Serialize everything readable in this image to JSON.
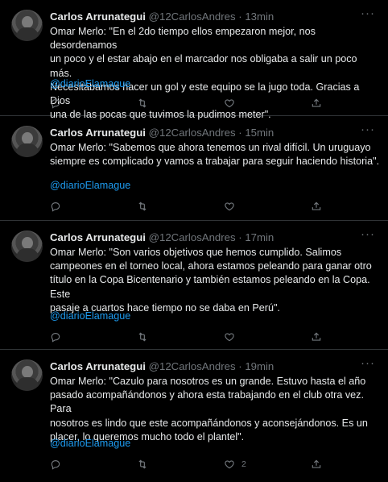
{
  "tweets": [
    {
      "name": "Carlos Arrunategui",
      "handle": "@12CarlosAndres",
      "dot": "·",
      "time": "13min",
      "lines": [
        "Omar Merlo: \"En el 2do tiempo ellos empezaron mejor, nos desordenamos",
        "un poco y el estar abajo en el marcador nos obligaba a salir un poco más.",
        "Necesitábamos hacer un gol y este equipo se la jugo toda. Gracias a Dios",
        "una de las pocas que tuvimos la pudimos meter\"."
      ],
      "link": "@diarioElamague",
      "likes": ""
    },
    {
      "name": "Carlos Arrunategui",
      "handle": "@12CarlosAndres",
      "dot": "·",
      "time": "15min",
      "lines": [
        "Omar Merlo: \"Sabemos que ahora tenemos un rival difícil. Un uruguayo",
        "siempre es complicado y vamos a trabajar para seguir haciendo historia\"."
      ],
      "link": "@diarioElamague",
      "likes": ""
    },
    {
      "name": "Carlos Arrunategui",
      "handle": "@12CarlosAndres",
      "dot": "·",
      "time": "17min",
      "lines": [
        "Omar Merlo: \"Son varios objetivos que hemos cumplido. Salimos",
        "campeones en el torneo local, ahora estamos peleando para ganar otro",
        "título en la Copa Bicentenario y también estamos peleando en la Copa. Este",
        "pasaje a cuartos hace tiempo no se daba en Perú\"."
      ],
      "link": "@diarioElamague",
      "likes": ""
    },
    {
      "name": "Carlos Arrunategui",
      "handle": "@12CarlosAndres",
      "dot": "·",
      "time": "19min",
      "lines": [
        "Omar Merlo: \"Cazulo para nosotros es un grande. Estuvo hasta el año",
        "pasado acompañándonos y ahora esta trabajando en el club otra vez. Para",
        "nosotros es lindo que este acompañándonos y aconsejándonos. Es un",
        "placer, lo queremos mucho todo el plantel\"."
      ],
      "link": "@diarioElamague",
      "likes": "2"
    }
  ],
  "more_glyph": "···",
  "icons": {
    "reply": "reply-icon",
    "retweet": "retweet-icon",
    "like": "heart-icon",
    "share": "share-icon",
    "more": "more-icon"
  },
  "colors": {
    "background": "#000000",
    "text": "#e7e9ea",
    "muted": "#71767b",
    "link": "#1d9bf0",
    "divider": "#2f3336"
  }
}
